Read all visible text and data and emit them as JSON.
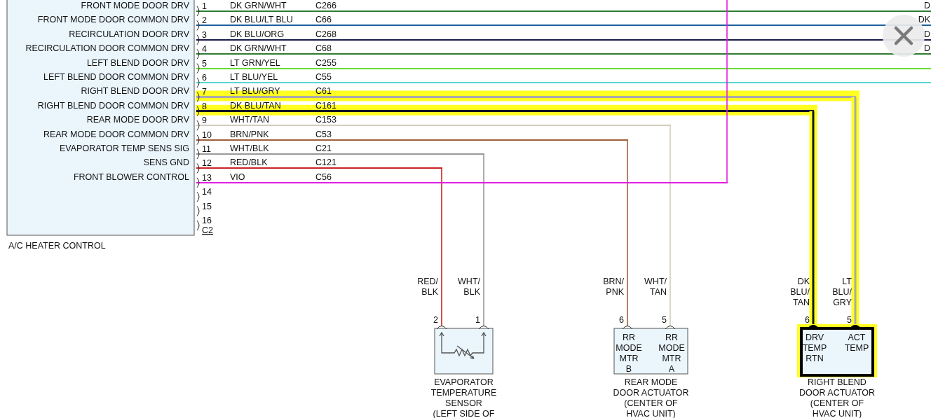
{
  "module": {
    "title": "A/C HEATER CONTROL",
    "connector": "C2",
    "pins": [
      {
        "number": "1",
        "function": "FRONT MODE DOOR DRV",
        "wire_color": "DK GRN/WHT",
        "circuit": "C266",
        "color": "#2e7d32",
        "highlighted": false,
        "kind": "offpage",
        "far_label": "D"
      },
      {
        "number": "2",
        "function": "FRONT MODE DOOR COMMON DRV",
        "wire_color": "DK BLU/LT BLU",
        "circuit": "C66",
        "color": "#1f5f9a",
        "highlighted": false,
        "kind": "offpage",
        "far_label": "DK"
      },
      {
        "number": "3",
        "function": "RECIRCULATION DOOR DRV",
        "wire_color": "DK BLU/ORG",
        "circuit": "C268",
        "color": "#1a1a48",
        "highlighted": false,
        "kind": "offpage",
        "far_label": "D"
      },
      {
        "number": "4",
        "function": "RECIRCULATION DOOR COMMON DRV",
        "wire_color": "DK GRN/WHT",
        "circuit": "C68",
        "color": "#2e7d32",
        "highlighted": false,
        "kind": "offpage",
        "far_label": "D"
      },
      {
        "number": "5",
        "function": "LEFT BLEND DOOR DRV",
        "wire_color": "LT GRN/YEL",
        "circuit": "C255",
        "color": "#66dd33",
        "highlighted": false,
        "kind": "offpage"
      },
      {
        "number": "6",
        "function": "LEFT BLEND DOOR COMMON DRV",
        "wire_color": "LT BLU/YEL",
        "circuit": "C55",
        "color": "#55d8d0",
        "highlighted": false,
        "kind": "offpage"
      },
      {
        "number": "7",
        "function": "RIGHT BLEND DOOR DRV",
        "wire_color": "LT BLU/GRY",
        "circuit": "C61",
        "color": "#aaaaaa",
        "highlighted": true,
        "kind": "drop"
      },
      {
        "number": "8",
        "function": "RIGHT BLEND DOOR COMMON DRV",
        "wire_color": "DK BLU/TAN",
        "circuit": "C161",
        "color": "#101820",
        "highlighted": true,
        "kind": "drop"
      },
      {
        "number": "9",
        "function": "REAR MODE DOOR DRV",
        "wire_color": "WHT/TAN",
        "circuit": "C153",
        "color": "#d4ccc0",
        "highlighted": false,
        "kind": "drop"
      },
      {
        "number": "10",
        "function": "REAR MODE DOOR COMMON DRV",
        "wire_color": "BRN/PNK",
        "circuit": "C53",
        "color": "#a0603a",
        "highlighted": false,
        "kind": "drop"
      },
      {
        "number": "11",
        "function": "EVAPORATOR TEMP SENS SIG",
        "wire_color": "WHT/BLK",
        "circuit": "C21",
        "color": "#999999",
        "highlighted": false,
        "kind": "drop"
      },
      {
        "number": "12",
        "function": "SENS GND",
        "wire_color": "RED/BLK",
        "circuit": "C121",
        "color": "#cc2222",
        "highlighted": false,
        "kind": "drop"
      },
      {
        "number": "13",
        "function": "FRONT BLOWER CONTROL",
        "wire_color": "VIO",
        "circuit": "C56",
        "color": "#e020e0",
        "highlighted": false,
        "kind": "offpage_up"
      },
      {
        "number": "14",
        "kind": "unused"
      },
      {
        "number": "15",
        "kind": "unused"
      },
      {
        "number": "16",
        "kind": "unused"
      }
    ]
  },
  "components": [
    {
      "kind": "thermistor",
      "highlighted": false,
      "name": [
        "EVAPORATOR",
        "TEMPERATURE",
        "SENSOR",
        "(LEFT SIDE OF"
      ],
      "terminals": [
        {
          "number": "2",
          "wire_label": [
            "RED/",
            "BLK"
          ]
        },
        {
          "number": "1",
          "wire_label": [
            "WHT/",
            "BLK"
          ]
        }
      ]
    },
    {
      "kind": "actuator",
      "highlighted": false,
      "name": [
        "REAR MODE",
        "DOOR ACTUATOR",
        "(CENTER OF",
        "HVAC UNIT)"
      ],
      "terminals": [
        {
          "number": "6",
          "wire_label": [
            "BRN/",
            "PNK"
          ],
          "function": [
            "RR",
            "MODE",
            "MTR",
            "B"
          ]
        },
        {
          "number": "5",
          "wire_label": [
            "WHT/",
            "TAN"
          ],
          "function": [
            "RR",
            "MODE",
            "MTR",
            "A"
          ]
        }
      ]
    },
    {
      "kind": "actuator",
      "highlighted": true,
      "name": [
        "RIGHT BLEND",
        "DOOR ACTUATOR",
        "(CENTER OF",
        "HVAC UNIT)"
      ],
      "terminals": [
        {
          "number": "6",
          "wire_label": [
            "DK",
            "BLU/",
            "TAN"
          ],
          "function": [
            "DRV",
            "TEMP",
            "RTN"
          ]
        },
        {
          "number": "5",
          "wire_label": [
            "LT",
            "BLU/",
            "GRY"
          ],
          "function": [
            "ACT",
            "TEMP"
          ]
        }
      ]
    }
  ],
  "close_button": {
    "kind": "close"
  }
}
